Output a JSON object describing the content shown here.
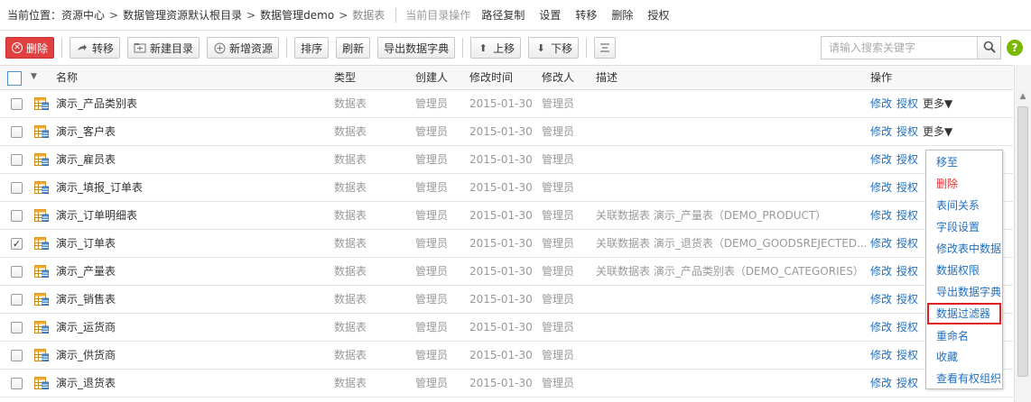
{
  "breadcrumb": {
    "label": "当前位置：",
    "items": [
      "资源中心",
      "数据管理资源默认根目录",
      "数据管理demo"
    ],
    "current": "数据表",
    "separator": ">",
    "ops_label": "当前目录操作",
    "ops": [
      "路径复制",
      "设置",
      "转移",
      "删除",
      "授权"
    ]
  },
  "toolbar": {
    "delete": "删除",
    "move": "转移",
    "new_folder": "新建目录",
    "new_resource": "新增资源",
    "sort": "排序",
    "refresh": "刷新",
    "export_dict": "导出数据字典",
    "move_up": "上移",
    "move_down": "下移"
  },
  "search": {
    "placeholder": "请输入搜索关键字"
  },
  "help_label": "?",
  "table": {
    "headers": {
      "name": "名称",
      "type": "类型",
      "creator": "创建人",
      "modified_time": "修改时间",
      "modifier": "修改人",
      "description": "描述",
      "actions": "操作"
    },
    "rows": [
      {
        "name": "演示_产品类别表",
        "type": "数据表",
        "creator": "管理员",
        "time": "2015-01-30",
        "modifier": "管理员",
        "desc": "",
        "checked": "",
        "modify": "修改",
        "auth": "授权",
        "more": "更多▼"
      },
      {
        "name": "演示_客户表",
        "type": "数据表",
        "creator": "管理员",
        "time": "2015-01-30",
        "modifier": "管理员",
        "desc": "",
        "checked": "",
        "modify": "修改",
        "auth": "授权",
        "more": "更多▼"
      },
      {
        "name": "演示_雇员表",
        "type": "数据表",
        "creator": "管理员",
        "time": "2015-01-30",
        "modifier": "管理员",
        "desc": "",
        "checked": "",
        "modify": "修改",
        "auth": "授权",
        "more": ""
      },
      {
        "name": "演示_填报_订单表",
        "type": "数据表",
        "creator": "管理员",
        "time": "2015-01-30",
        "modifier": "管理员",
        "desc": "",
        "checked": "",
        "modify": "修改",
        "auth": "授权",
        "more": ""
      },
      {
        "name": "演示_订单明细表",
        "type": "数据表",
        "creator": "管理员",
        "time": "2015-01-30",
        "modifier": "管理员",
        "desc": "关联数据表 演示_产量表（DEMO_PRODUCT）",
        "checked": "",
        "modify": "修改",
        "auth": "授权",
        "more": ""
      },
      {
        "name": "演示_订单表",
        "type": "数据表",
        "creator": "管理员",
        "time": "2015-01-30",
        "modifier": "管理员",
        "desc": "关联数据表 演示_退货表（DEMO_GOODSREJECTED...",
        "checked": "✓",
        "modify": "修改",
        "auth": "授权",
        "more": ""
      },
      {
        "name": "演示_产量表",
        "type": "数据表",
        "creator": "管理员",
        "time": "2015-01-30",
        "modifier": "管理员",
        "desc": "关联数据表 演示_产品类别表（DEMO_CATEGORIES）",
        "checked": "",
        "modify": "修改",
        "auth": "授权",
        "more": ""
      },
      {
        "name": "演示_销售表",
        "type": "数据表",
        "creator": "管理员",
        "time": "2015-01-30",
        "modifier": "管理员",
        "desc": "",
        "checked": "",
        "modify": "修改",
        "auth": "授权",
        "more": ""
      },
      {
        "name": "演示_运货商",
        "type": "数据表",
        "creator": "管理员",
        "time": "2015-01-30",
        "modifier": "管理员",
        "desc": "",
        "checked": "",
        "modify": "修改",
        "auth": "授权",
        "more": ""
      },
      {
        "name": "演示_供货商",
        "type": "数据表",
        "creator": "管理员",
        "time": "2015-01-30",
        "modifier": "管理员",
        "desc": "",
        "checked": "",
        "modify": "修改",
        "auth": "授权",
        "more": ""
      },
      {
        "name": "演示_退货表",
        "type": "数据表",
        "creator": "管理员",
        "time": "2015-01-30",
        "modifier": "管理员",
        "desc": "",
        "checked": "",
        "modify": "修改",
        "auth": "授权",
        "more": ""
      }
    ]
  },
  "more_menu": {
    "items": [
      "移至",
      "删除",
      "表间关系",
      "字段设置",
      "修改表中数据",
      "数据权限",
      "导出数据字典",
      "数据过滤器",
      "重命名",
      "收藏",
      "查看有权组织"
    ]
  },
  "colors": {
    "link": "#1f6fbf",
    "danger": "#e04040",
    "highlight_border": "#e02020",
    "help": "#7ab800"
  }
}
